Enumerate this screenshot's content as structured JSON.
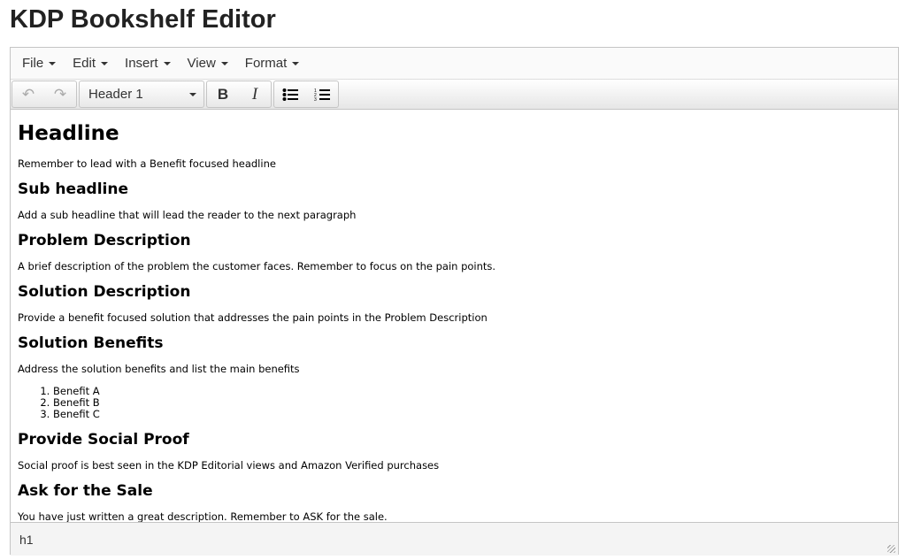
{
  "app": {
    "title": "KDP Bookshelf Editor"
  },
  "menubar": [
    "File",
    "Edit",
    "Insert",
    "View",
    "Format"
  ],
  "toolbar": {
    "undo": "↶",
    "redo": "↷",
    "block_format": "Header 1",
    "bold": "B",
    "italic": "I"
  },
  "content": {
    "h1": "Headline",
    "p1": "Remember to lead with a Benefit focused headline",
    "sections": [
      {
        "h": "Sub headline",
        "p": "Add a sub headline that will lead the reader to the next paragraph"
      },
      {
        "h": "Problem Description",
        "p": "A brief description of the problem the customer faces. Remember to focus on the pain points."
      },
      {
        "h": "Solution Description",
        "p": "Provide a benefit focused solution that addresses the pain points in the Problem Description"
      },
      {
        "h": "Solution Benefits",
        "p": "Address the solution benefits and list the main benefits"
      },
      {
        "h": "Provide Social Proof",
        "p": "Social proof is best seen in the KDP Editorial views and Amazon Verified purchases"
      },
      {
        "h": "Ask for the Sale",
        "p": "You have just written a great description. Remember to ASK for the sale."
      }
    ],
    "benefits": [
      "Benefit A",
      "Benefit B",
      "Benefit C"
    ]
  },
  "statusbar": {
    "path": "h1"
  }
}
